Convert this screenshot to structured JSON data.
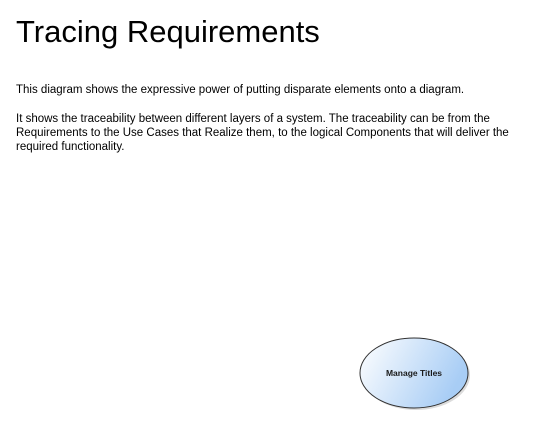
{
  "diagram": {
    "title": "Tracing Requirements",
    "paragraphs": [
      "This diagram shows the expressive power of putting disparate elements onto a diagram.",
      "It shows the traceability between different layers of a system.  The traceability can be from the Requirements to the Use Cases that Realize them, to the logical Components that will deliver the required functionality."
    ],
    "use_case": {
      "label": "Manage Titles",
      "fill_start": "#ffffff",
      "fill_end": "#a8cdf5",
      "stroke": "#303030"
    }
  }
}
